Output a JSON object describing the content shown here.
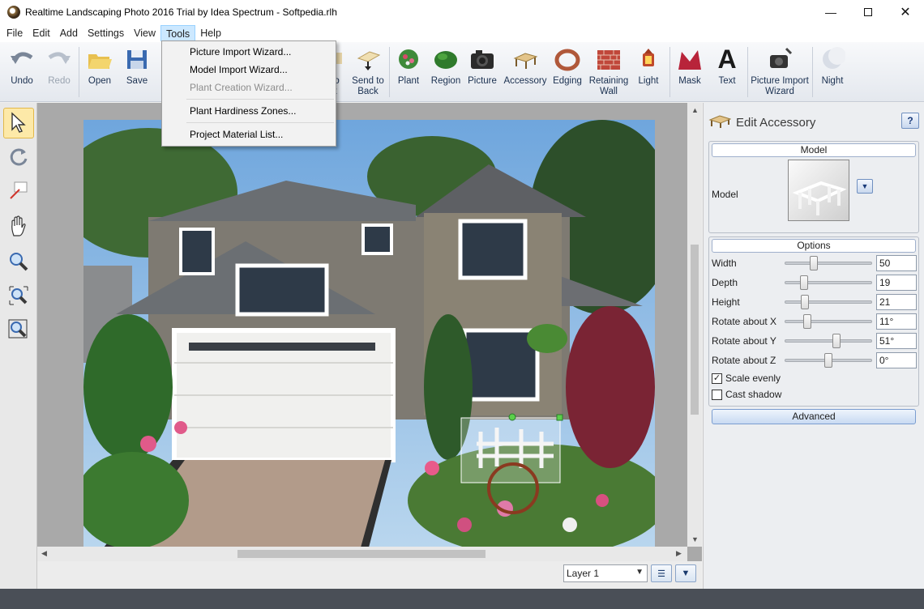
{
  "window": {
    "title": "Realtime Landscaping Photo 2016 Trial by Idea Spectrum - Softpedia.rlh",
    "minimize_icon": "minimize-icon",
    "maximize_icon": "maximize-icon",
    "close_icon": "close-icon"
  },
  "menubar": {
    "items": [
      "File",
      "Edit",
      "Add",
      "Settings",
      "View",
      "Tools",
      "Help"
    ],
    "active": "Tools"
  },
  "tools_menu": {
    "items": [
      {
        "label": "Picture Import Wizard...",
        "enabled": true
      },
      {
        "label": "Model Import Wizard...",
        "enabled": true
      },
      {
        "label": "Plant Creation Wizard...",
        "enabled": false
      },
      {
        "label": "Plant Hardiness Zones...",
        "enabled": true
      },
      {
        "label": "Project Material List...",
        "enabled": true
      }
    ]
  },
  "toolbar": {
    "undo": "Undo",
    "redo": "Redo",
    "open": "Open",
    "save": "Save",
    "bring_front_partial": "to\nt",
    "send_back": "Send to\nBack",
    "plant": "Plant",
    "region": "Region",
    "picture": "Picture",
    "accessory": "Accessory",
    "edging": "Edging",
    "retaining_wall": "Retaining\nWall",
    "light": "Light",
    "mask": "Mask",
    "text": "Text",
    "picture_import_wizard": "Picture Import\nWizard",
    "night": "Night"
  },
  "left_tools": [
    "select-arrow-icon",
    "rotate-icon",
    "measure-icon",
    "pan-hand-icon",
    "zoom-icon",
    "zoom-fit-icon",
    "zoom-out-icon"
  ],
  "layer": {
    "selected": "Layer 1"
  },
  "panel": {
    "title": "Edit Accessory",
    "help_label": "?",
    "model_group": "Model",
    "model_label": "Model",
    "options_group": "Options",
    "fields": [
      {
        "label": "Width",
        "value": "50",
        "pos": 0.3
      },
      {
        "label": "Depth",
        "value": "19",
        "pos": 0.18
      },
      {
        "label": "Height",
        "value": "21",
        "pos": 0.19
      },
      {
        "label": "Rotate about X",
        "value": "11°",
        "pos": 0.22
      },
      {
        "label": "Rotate about Y",
        "value": "51°",
        "pos": 0.58
      },
      {
        "label": "Rotate about Z",
        "value": "0°",
        "pos": 0.48
      }
    ],
    "scale_evenly": {
      "label": "Scale evenly",
      "checked": true
    },
    "cast_shadow": {
      "label": "Cast shadow",
      "checked": false
    },
    "advanced": "Advanced"
  },
  "colors": {
    "menu_highlight": "#cce8ff",
    "statusbar": "#4a4f57",
    "sky": "#7fb4e6",
    "house": "#7e7a72"
  }
}
